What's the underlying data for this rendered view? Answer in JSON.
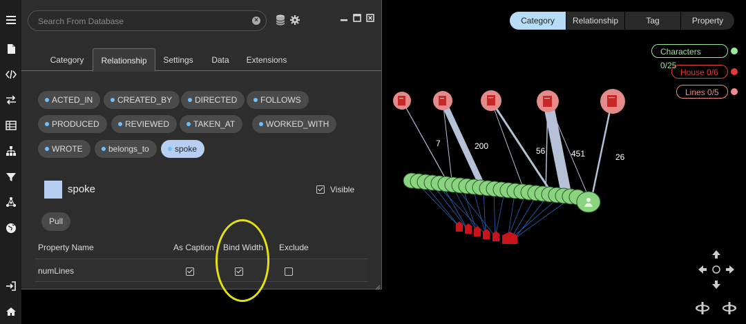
{
  "search": {
    "placeholder": "Search From Database"
  },
  "panel_tabs": [
    "Category",
    "Relationship",
    "Settings",
    "Data",
    "Extensions"
  ],
  "relationship_types": [
    "ACTED_IN",
    "CREATED_BY",
    "DIRECTED",
    "FOLLOWS",
    "PRODUCED",
    "REVIEWED",
    "TAKEN_AT",
    "WORKED_WITH",
    "WROTE",
    "belongs_to",
    "spoke"
  ],
  "selected": {
    "name": "spoke",
    "visible_label": "Visible",
    "visible": true,
    "color": "#b7cff2"
  },
  "pull_label": "Pull",
  "table": {
    "headers": [
      "Property Name",
      "As Caption",
      "Bind Width",
      "Exclude"
    ],
    "rows": [
      {
        "property": "numLines",
        "as_caption": true,
        "bind_width": true,
        "exclude": false
      }
    ]
  },
  "view_tabs": [
    "Category",
    "Relationship",
    "Tag",
    "Property"
  ],
  "legend": [
    {
      "label": "Characters 0/25",
      "color": "#9ee89a",
      "icon": "person-icon"
    },
    {
      "label": "House 0/6",
      "color": "#e23a3a",
      "icon": "house-icon"
    },
    {
      "label": "Lines 0/5",
      "color": "#f08c8c",
      "icon": "document-icon"
    }
  ],
  "edge_labels": [
    "7",
    "200",
    "56",
    "451",
    "26"
  ],
  "accent": "#b7dcf6"
}
